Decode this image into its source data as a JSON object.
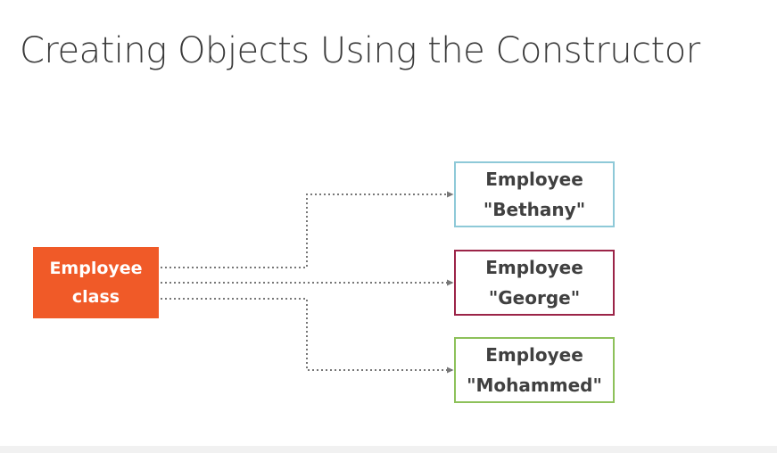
{
  "slide": {
    "title": "Creating Objects Using the Constructor"
  },
  "diagram": {
    "source": {
      "line1": "Employee",
      "line2": "class",
      "color": "#f05a28"
    },
    "targets": [
      {
        "line1": "Employee",
        "line2": "\"Bethany\"",
        "border_color": "#8ec9d8"
      },
      {
        "line1": "Employee",
        "line2": "\"George\"",
        "border_color": "#9b2448"
      },
      {
        "line1": "Employee",
        "line2": "\"Mohammed\"",
        "border_color": "#8dc15a"
      }
    ],
    "connector_style": "dotted-arrow",
    "connector_color": "#777777"
  }
}
